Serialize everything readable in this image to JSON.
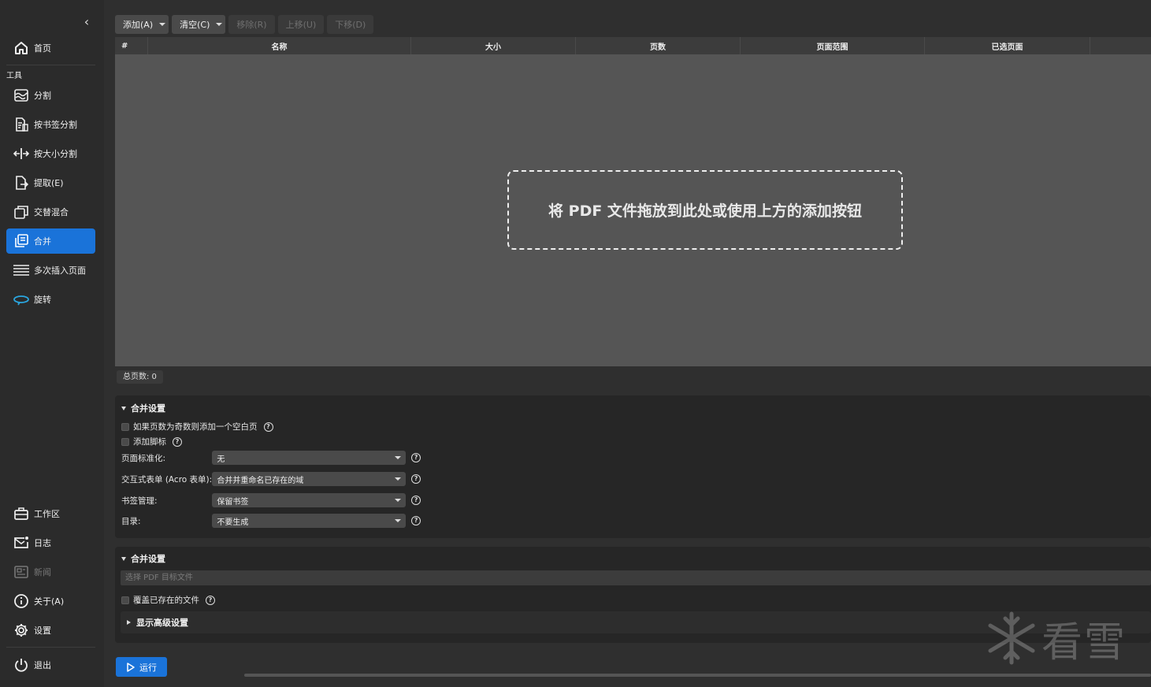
{
  "sidebar": {
    "home": "首页",
    "group_tools": "工具",
    "items": [
      {
        "label": "分割",
        "icon": "split-wave-icon"
      },
      {
        "label": "按书签分割",
        "icon": "split-bookmark-icon"
      },
      {
        "label": "按大小分割",
        "icon": "split-size-icon"
      },
      {
        "label": "提取(E)",
        "icon": "extract-icon"
      },
      {
        "label": "交替混合",
        "icon": "alternate-mix-icon"
      },
      {
        "label": "合并",
        "icon": "merge-icon"
      },
      {
        "label": "多次插入页面",
        "icon": "insert-pages-icon"
      },
      {
        "label": "旋转",
        "icon": "rotate-icon"
      }
    ],
    "workspace": "工作区",
    "log": "日志",
    "news": "新闻",
    "about": "关于(A)",
    "settings": "设置",
    "exit": "退出"
  },
  "toolbar": {
    "add": "添加(A)",
    "clear": "清空(C)",
    "remove": "移除(R)",
    "move_up": "上移(U)",
    "move_down": "下移(D)"
  },
  "table": {
    "columns": [
      "#",
      "名称",
      "大小",
      "页数",
      "页面范围",
      "已选页面"
    ],
    "rows": [],
    "drop_hint": "将 PDF 文件拖放到此处或使用上方的添加按钮"
  },
  "status": {
    "total_pages": "总页数: 0"
  },
  "merge_settings": {
    "title": "合并设置",
    "blank_page_if_odd": "如果页数为奇数则添加一个空白页",
    "add_footer": "添加脚标",
    "normalize_label": "页面标准化:",
    "normalize_value": "无",
    "acroform_label": "交互式表单 (Acro 表单):",
    "acroform_value": "合并并重命名已存在的域",
    "bookmarks_label": "书签管理:",
    "bookmarks_value": "保留书签",
    "toc_label": "目录:",
    "toc_value": "不要生成"
  },
  "output_settings": {
    "title": "合并设置",
    "destination_placeholder": "选择 PDF 目标文件",
    "overwrite": "覆盖已存在的文件",
    "advanced": "显示高级设置"
  },
  "run_button": "运行",
  "watermark": "看雪",
  "colors": {
    "accent": "#1a73d9",
    "background": "#2b2b2b",
    "table_area": "#555555",
    "panel": "#262626"
  }
}
